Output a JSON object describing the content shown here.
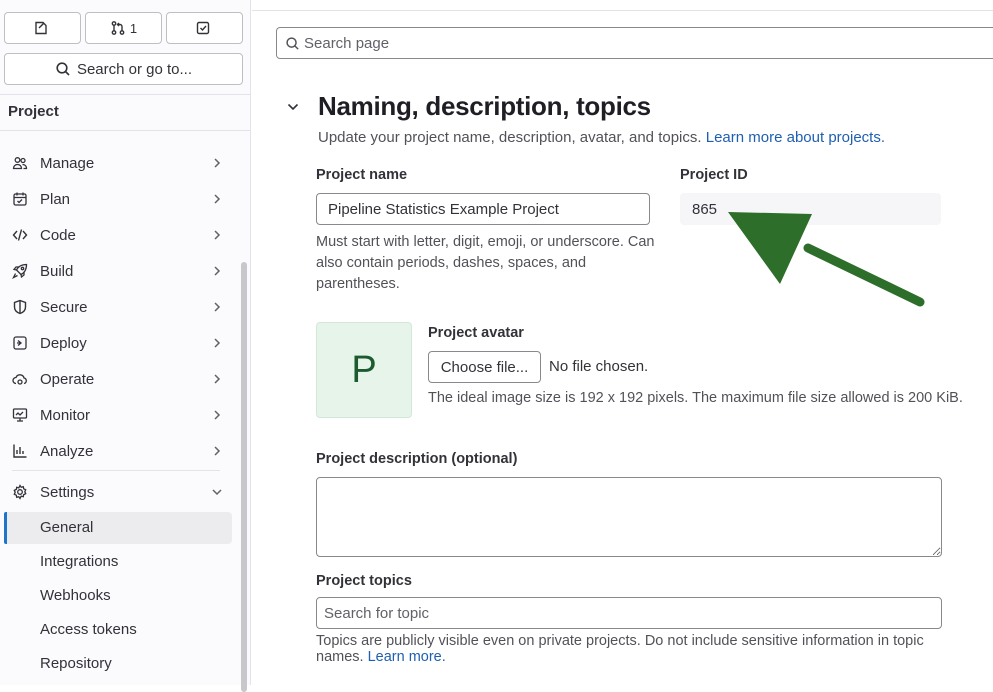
{
  "sidebar": {
    "top_buttons": [
      {
        "icon": "issues-icon",
        "label": ""
      },
      {
        "icon": "merge-request-icon",
        "label": "1"
      },
      {
        "icon": "todo-icon",
        "label": ""
      }
    ],
    "search_label": "Search or go to...",
    "project_heading": "Project",
    "nav_items": [
      {
        "label": "Manage",
        "icon": "users-icon"
      },
      {
        "label": "Plan",
        "icon": "calendar-icon"
      },
      {
        "label": "Code",
        "icon": "code-icon"
      },
      {
        "label": "Build",
        "icon": "rocket-icon"
      },
      {
        "label": "Secure",
        "icon": "shield-icon"
      },
      {
        "label": "Deploy",
        "icon": "deploy-icon"
      },
      {
        "label": "Operate",
        "icon": "cloud-gear-icon"
      },
      {
        "label": "Monitor",
        "icon": "monitor-icon"
      },
      {
        "label": "Analyze",
        "icon": "chart-icon"
      }
    ],
    "settings": {
      "label": "Settings",
      "icon": "gear-icon",
      "sub_items": [
        "General",
        "Integrations",
        "Webhooks",
        "Access tokens",
        "Repository"
      ],
      "active": "General"
    }
  },
  "main": {
    "search_placeholder": "Search page",
    "section": {
      "title": "Naming, description, topics",
      "description": "Update your project name, description, avatar, and topics.",
      "learn_more_link": "Learn more about projects."
    },
    "project_name": {
      "label": "Project name",
      "value": "Pipeline Statistics Example Project",
      "help": "Must start with letter, digit, emoji, or underscore. Can also contain periods, dashes, spaces, and parentheses."
    },
    "project_id": {
      "label": "Project ID",
      "value": "865"
    },
    "avatar": {
      "letter": "P",
      "label": "Project avatar",
      "button": "Choose file...",
      "no_file": "No file chosen.",
      "help": "The ideal image size is 192 x 192 pixels. The maximum file size allowed is 200 KiB."
    },
    "description_field": {
      "label": "Project description (optional)",
      "value": ""
    },
    "topics": {
      "label": "Project topics",
      "placeholder": "Search for topic",
      "help": "Topics are publicly visible even on private projects. Do not include sensitive information in topic names.",
      "learn_more": "Learn more."
    }
  },
  "colors": {
    "accent": "#1f75cb",
    "link": "#1f5fb0",
    "annotation_arrow": "#2c6e2a",
    "avatar_bg": "#e6f4ea"
  }
}
